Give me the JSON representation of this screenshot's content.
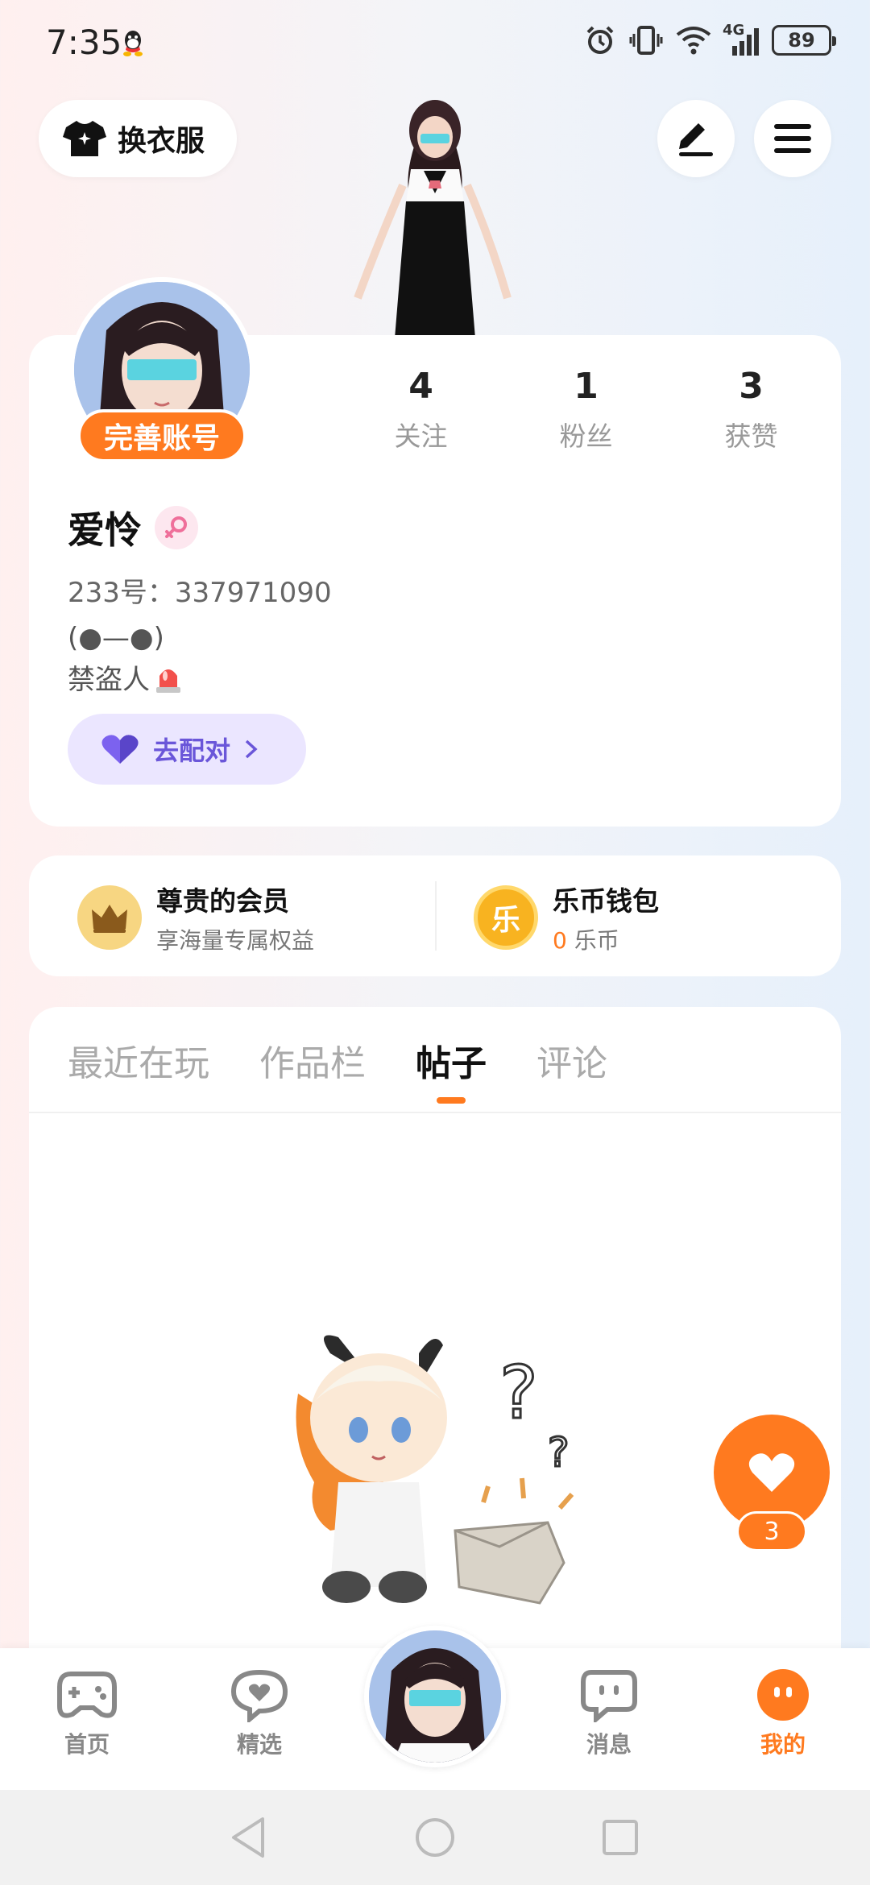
{
  "status_bar": {
    "time": "7:35",
    "network": "4G",
    "battery": "89",
    "icons": [
      "qq-icon",
      "alarm-icon",
      "vibrate-icon",
      "wifi-icon",
      "signal-icon",
      "battery-icon"
    ]
  },
  "header": {
    "change_clothes_label": "换衣服",
    "edit_icon": "pen-icon",
    "menu_icon": "menu-icon"
  },
  "profile": {
    "complete_account_label": "完善账号",
    "stats": [
      {
        "value": "4",
        "label": "关注"
      },
      {
        "value": "1",
        "label": "粉丝"
      },
      {
        "value": "3",
        "label": "获赞"
      }
    ],
    "name": "爱怜",
    "gender": "female",
    "id_text": "233号：337971090",
    "bio_line1": "(●—●)",
    "bio_line2": "禁盗人",
    "match_label": "去配对"
  },
  "vip": {
    "title": "尊贵的会员",
    "subtitle": "享海量专属权益"
  },
  "wallet": {
    "coin_glyph": "乐",
    "title": "乐币钱包",
    "amount": "0",
    "unit": "乐币"
  },
  "tabs": [
    {
      "label": "最近在玩",
      "active": false
    },
    {
      "label": "作品栏",
      "active": false
    },
    {
      "label": "帖子",
      "active": true
    },
    {
      "label": "评论",
      "active": false
    }
  ],
  "like_fab": {
    "count": "3"
  },
  "bottom_nav": [
    {
      "label": "首页",
      "icon": "gamepad-icon",
      "active": false
    },
    {
      "label": "精选",
      "icon": "heart-chat-icon",
      "active": false
    },
    {
      "label": "消息",
      "icon": "message-icon",
      "active": false
    },
    {
      "label": "我的",
      "icon": "mine-icon",
      "active": true
    }
  ],
  "colors": {
    "accent": "#ff7a1f",
    "match_bg": "#ebe6ff",
    "match_text": "#6a56d9"
  }
}
